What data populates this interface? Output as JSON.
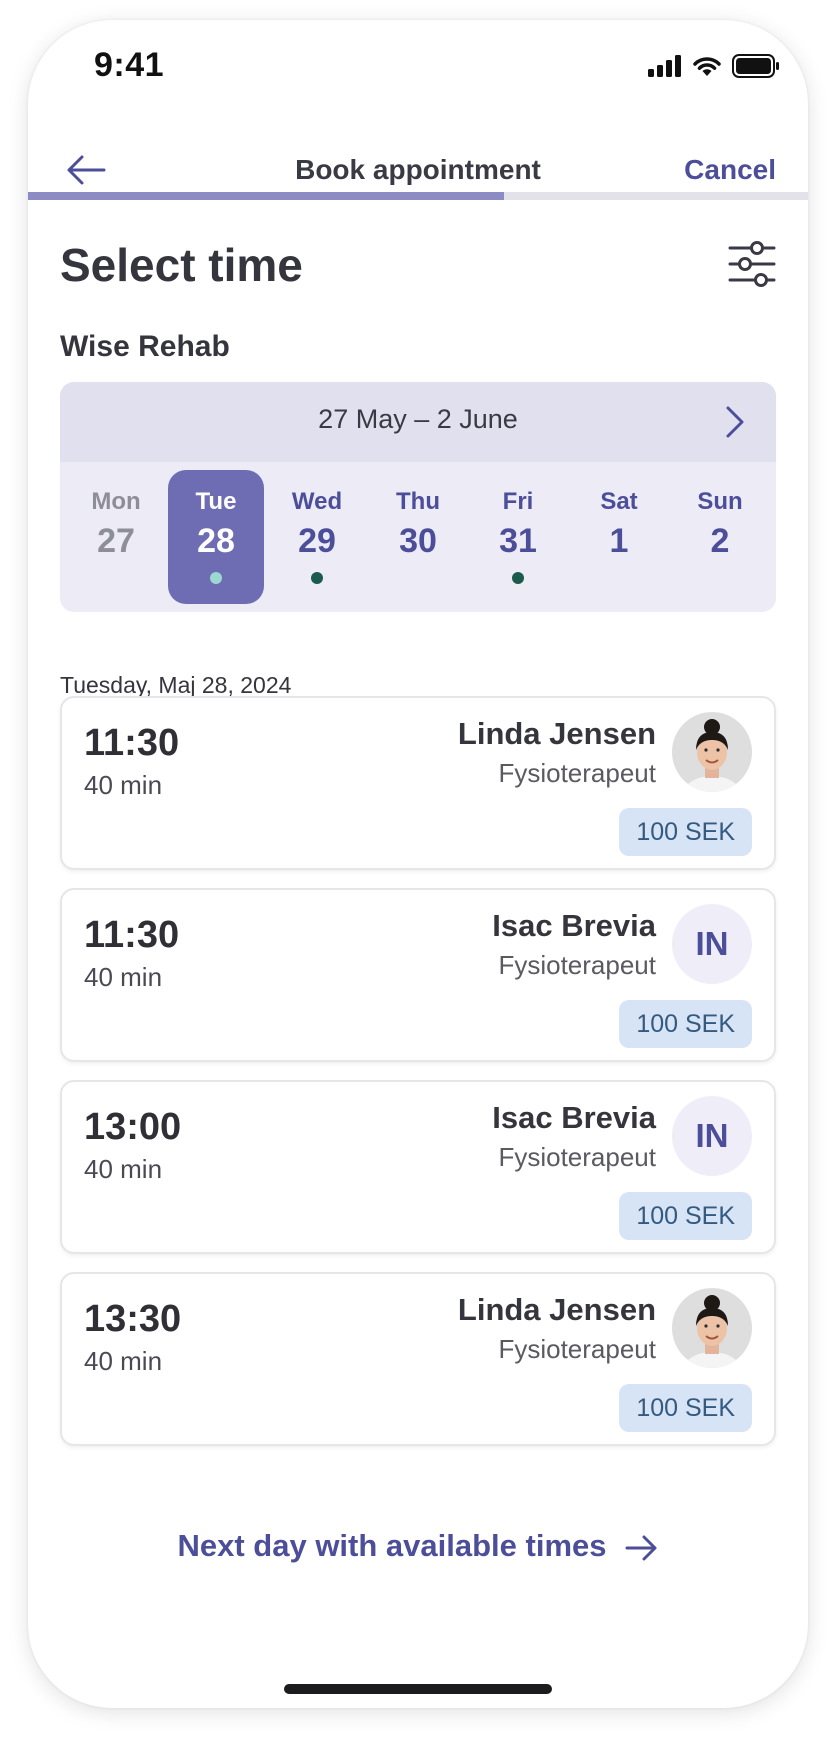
{
  "status_bar": {
    "time": "9:41"
  },
  "nav": {
    "title": "Book appointment",
    "cancel_label": "Cancel"
  },
  "booking_progress": 0.61,
  "page": {
    "heading": "Select time",
    "clinic": "Wise Rehab"
  },
  "week": {
    "range_label": "27 May – 2 June",
    "days": [
      {
        "name": "Mon",
        "num": "27",
        "state": "past",
        "has_times": false
      },
      {
        "name": "Tue",
        "num": "28",
        "state": "selected",
        "has_times": true
      },
      {
        "name": "Wed",
        "num": "29",
        "state": "normal",
        "has_times": true
      },
      {
        "name": "Thu",
        "num": "30",
        "state": "normal",
        "has_times": false
      },
      {
        "name": "Fri",
        "num": "31",
        "state": "normal",
        "has_times": true
      },
      {
        "name": "Sat",
        "num": "1",
        "state": "normal",
        "has_times": false
      },
      {
        "name": "Sun",
        "num": "2",
        "state": "normal",
        "has_times": false
      }
    ]
  },
  "date_label": "Tuesday, Maj 28, 2024",
  "slots": [
    {
      "time": "11:30",
      "duration": "40 min",
      "name": "Linda Jensen",
      "role": "Fysioterapeut",
      "avatar": "photo",
      "price": "100 SEK"
    },
    {
      "time": "11:30",
      "duration": "40 min",
      "name": "Isac Brevia",
      "role": "Fysioterapeut",
      "avatar": "initials",
      "initials": "IN",
      "price": "100 SEK"
    },
    {
      "time": "13:00",
      "duration": "40 min",
      "name": "Isac Brevia",
      "role": "Fysioterapeut",
      "avatar": "initials",
      "initials": "IN",
      "price": "100 SEK"
    },
    {
      "time": "13:30",
      "duration": "40 min",
      "name": "Linda Jensen",
      "role": "Fysioterapeut",
      "avatar": "photo",
      "price": "100 SEK"
    }
  ],
  "next_day_label": "Next day with available times",
  "colors": {
    "accent": "#4d4e9a",
    "selected_day": "#6e6db3",
    "progress_fill": "#8d8bc4",
    "price_bg": "#d6e4f6",
    "dot": "#1b5b4d"
  },
  "icons": [
    "back-arrow-icon",
    "filter-sliders-icon",
    "chevron-right-icon",
    "arrow-right-icon",
    "signal-icon",
    "wifi-icon",
    "battery-icon"
  ]
}
